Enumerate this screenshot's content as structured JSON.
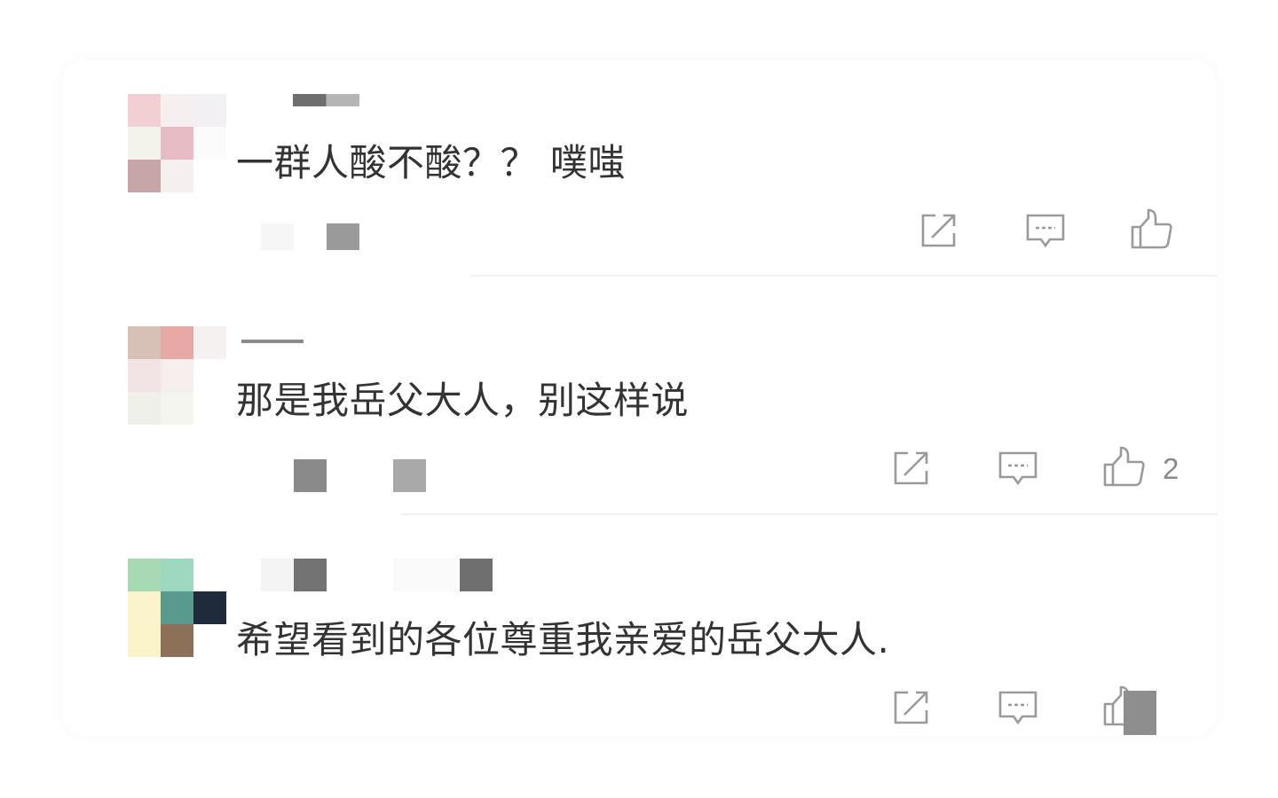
{
  "comments": [
    {
      "text": "一群人酸不酸？？ 噗嗤",
      "like_count": ""
    },
    {
      "text": "那是我岳父大人，别这样说",
      "like_count": "2"
    },
    {
      "text": "希望看到的各位尊重我亲爱的岳父大人.",
      "like_count": ""
    }
  ],
  "icons": {
    "share": "share-icon",
    "reply": "comment-icon",
    "like": "thumbs-up-icon"
  },
  "colors": {
    "text": "#333333",
    "icon": "#9a9a9a",
    "divider": "#f1f1f1"
  }
}
